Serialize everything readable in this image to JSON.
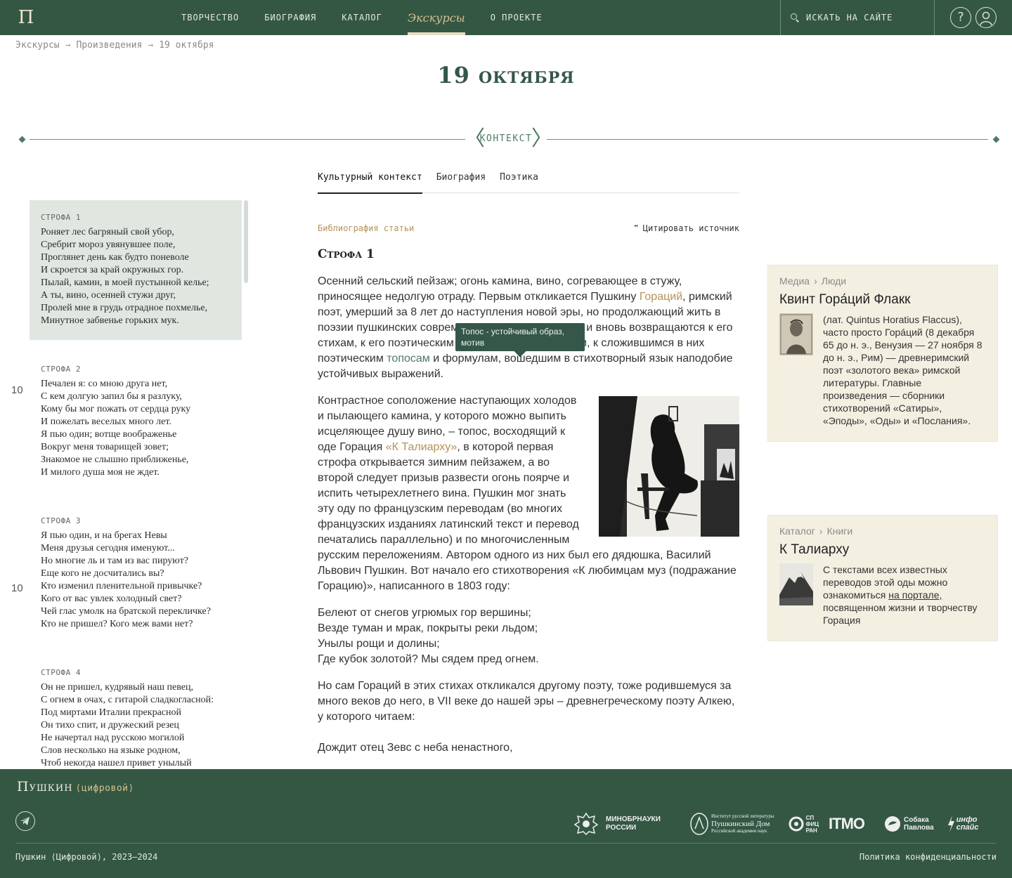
{
  "header": {
    "logo_letter": "П",
    "nav": [
      {
        "label": "Творчество"
      },
      {
        "label": "Биография"
      },
      {
        "label": "Каталог"
      },
      {
        "label": "Экскурсы",
        "active": true
      },
      {
        "label": "О проекте"
      }
    ],
    "search_placeholder": "ИСКАТЬ НА САЙТЕ"
  },
  "breadcrumb": [
    "Экскурсы",
    "Произведения",
    "19 октября"
  ],
  "page_title": "19 октября",
  "context_label": "контекст",
  "tabs": [
    {
      "label": "Культурный контекст",
      "active": true
    },
    {
      "label": "Биография"
    },
    {
      "label": "Поэтика"
    }
  ],
  "stanzas": [
    {
      "title": "СТРОФА 1",
      "lines": [
        "Роняет лес багряный свой убор,",
        "Сребрит мороз увянувшее поле,",
        "Проглянет день как будто поневоле",
        "И скроется за край окружных гор.",
        "Пылай, камин, в моей пустынной келье;",
        "А ты, вино, осенней стужи друг,",
        "Пролей мне в грудь отрадное похмелье,",
        "Минутное забвенье горьких мук."
      ]
    },
    {
      "title": "СТРОФА 2",
      "lines": [
        "Печален я: со мною друга нет,",
        "С кем долгую запил бы я разлуку,",
        "Кому бы мог пожать от сердца руку",
        "И пожелать веселых много лет.",
        "Я пью один; вотще воображенье",
        "Вокруг меня товарищей зовет;",
        "Знакомое не слышно приближенье,",
        "И милого душа моя не ждет."
      ]
    },
    {
      "title": "СТРОФА 3",
      "lines": [
        "Я пью один, и на брегах Невы",
        "Меня друзья сегодня именуют...",
        "Но многие ль и там из вас пируют?",
        "Еще кого не досчитались вы?",
        "Кто изменил пленительной привычке?",
        "Кого от вас увлек холодный свет?",
        "Чей глас умолк на братской перекличке?",
        "Кто не пришел? Кого меж вами нет?"
      ]
    },
    {
      "title": "СТРОФА 4",
      "lines": [
        "Он не пришел, кудрявый наш певец,",
        "С огнем в очах, с гитарой сладкогласной:",
        "Под миртами Италии прекрасной",
        "Он тихо спит, и дружеский резец",
        "Не начертал над русскою могилой",
        "Слов несколько на языке родном,",
        "Чтоб некогда нашел привет унылый"
      ]
    }
  ],
  "line_numbers": [
    "10",
    "10"
  ],
  "article": {
    "bib_link": "Библиография статьи",
    "cite_label": "Цитировать источник",
    "heading": "Строфа 1",
    "p1_a": "Осенний сельский пейзаж; огонь камина, вино, согревающее в стужу, приносящее недолгую отраду. Первым откликается Пушкину ",
    "p1_link": "Гораций",
    "p1_b": ", римский поэт, умерший за 8 лет до наступления новой эры, но продолжающий жить в поэзии пушкинских современников, которые вновь и вновь возвращаются к его стихам, к его поэтическим и жизненным принципам, к сложившимся в них поэтическим ",
    "p1_term": "топосам",
    "p1_c": " и формулам, вошедшим в стихотворный язык наподобие устойчивых выражений.",
    "p2_a": "Контрастное соположение наступающих холодов и пылающего камина, у которого можно выпить исцеляющее душу вино, – топос, восходящий к оде Горация ",
    "p2_link": "«К Талиарху»",
    "p2_b": ", в которой первая строфа открывается зимним пейзажем, а во второй следует призыв развести огонь поярче и испить четырехлетнего вина. Пушкин мог знать эту оду по французским переводам (во многих французских изданиях латинский текст и перевод печатались параллельно) и по многочисленным русским переложениям. Автором одного из них был его дядюшка, Василий Львович Пушкин. Вот начало его стихотворения «К любимцам муз (подражание Горацию)», написанного в 1803 году:",
    "verse": [
      "Белеют от снегов угрюмых гор вершины;",
      "Везде туман и мрак, покрыты реки льдом;",
      "Унылы рощи и долины;",
      "Где кубок золотой? Мы сядем пред огнем."
    ],
    "p3": "Но сам Гораций в этих стихах откликался другому поэту, тоже родившемуся за много веков до него, в VII веке до нашей эры – древнегреческому поэту Алкею, у которого читаем:",
    "p4": "Дождит отец Зевс с неба ненастного,"
  },
  "tooltip": "Топос - устойчивый образ, мотив",
  "cards": [
    {
      "bc": [
        "Медиа",
        "Люди"
      ],
      "title": "Квинт Гора́ций Флакк",
      "text": "(лат. Quintus Horatius Flaccus), часто просто Гора́ций (8 декабря 65 до н. э., Венузия — 27 ноября 8 до н. э., Рим) — древнеримский поэт «золотого века» римской литературы. Главные произведения — сборники стихотворений «Сатиры», «Эподы», «Оды» и «Послания»."
    },
    {
      "bc": [
        "Каталог",
        "Книги"
      ],
      "title": "К Талиарху",
      "text_a": "С текстами всех известных переводов этой оды можно ознакомиться ",
      "text_link": "на портале,",
      "text_b": " посвященном жизни и творчеству Горация"
    }
  ],
  "footer": {
    "brand": "Пушкин",
    "brand_sub": "⟨цифровой⟩",
    "partners": {
      "minobr": [
        "МИНОБРНАУКИ",
        "РОССИИ"
      ],
      "pushdom": [
        "Институт русской литературы",
        "Пушкинский Дом",
        "Российской академии наук"
      ],
      "spb": [
        "СП",
        "ФИЦ",
        "РАН"
      ],
      "itmo": "ITMO",
      "sobaka": [
        "Собака",
        "Павлова"
      ],
      "info": [
        "инфо",
        "спайс"
      ]
    },
    "copyright": "Пушкин ⟨Цифровой⟩, 2023–2024",
    "privacy": "Политика конфиденциальности"
  }
}
